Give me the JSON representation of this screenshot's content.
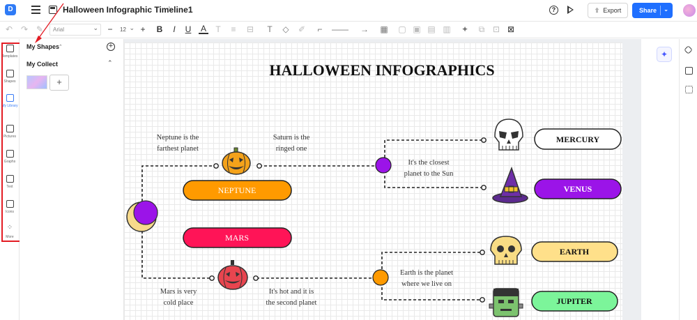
{
  "app": {
    "logo": "D",
    "document_title": "Halloween Infographic Timeline1",
    "export_label": "Export",
    "share_label": "Share"
  },
  "toolbar": {
    "font_name": "Arial",
    "font_size": "12"
  },
  "left_rail": {
    "items": [
      {
        "label": "Templates",
        "icon": "templates-icon"
      },
      {
        "label": "Shapes",
        "icon": "shapes-icon"
      },
      {
        "label": "My Library",
        "icon": "library-icon",
        "active": true
      },
      {
        "label": "Pictures",
        "icon": "pictures-icon"
      },
      {
        "label": "Graphs",
        "icon": "graphs-icon"
      },
      {
        "label": "Text",
        "icon": "text-icon"
      },
      {
        "label": "Icons",
        "icon": "icons-icon"
      },
      {
        "label": "More",
        "icon": "more-icon"
      }
    ]
  },
  "library": {
    "my_shapes": "My Shapes",
    "my_collect": "My Collect"
  },
  "infographic": {
    "title": "HALLOWEEN INFOGRAPHICS",
    "planets": {
      "mercury": "MERCURY",
      "venus": "VENUS",
      "earth": "EARTH",
      "jupiter": "JUPITER",
      "neptune": "NEPTUNE",
      "mars": "MARS"
    },
    "notes": {
      "neptune_1": "Neptune is the",
      "neptune_2": "farthest planet",
      "saturn_1": "Saturn is the",
      "saturn_2": "ringed one",
      "closest_1": "It's the closest",
      "closest_2": "planet to the Sun",
      "earth_1": "Earth is the planet",
      "earth_2": "where we live on",
      "mars_1": "Mars is very",
      "mars_2": "cold place",
      "hot_1": "It's hot and it is",
      "hot_2": "the second planet"
    },
    "colors": {
      "mercury": "#ffffff",
      "venus": "#9b14e8",
      "earth": "#ffe08a",
      "jupiter": "#7cf59a",
      "neptune": "#ff9a00",
      "mars": "#ff1457",
      "purple_dot": "#9b14e8",
      "orange_dot": "#ff9a00"
    }
  }
}
